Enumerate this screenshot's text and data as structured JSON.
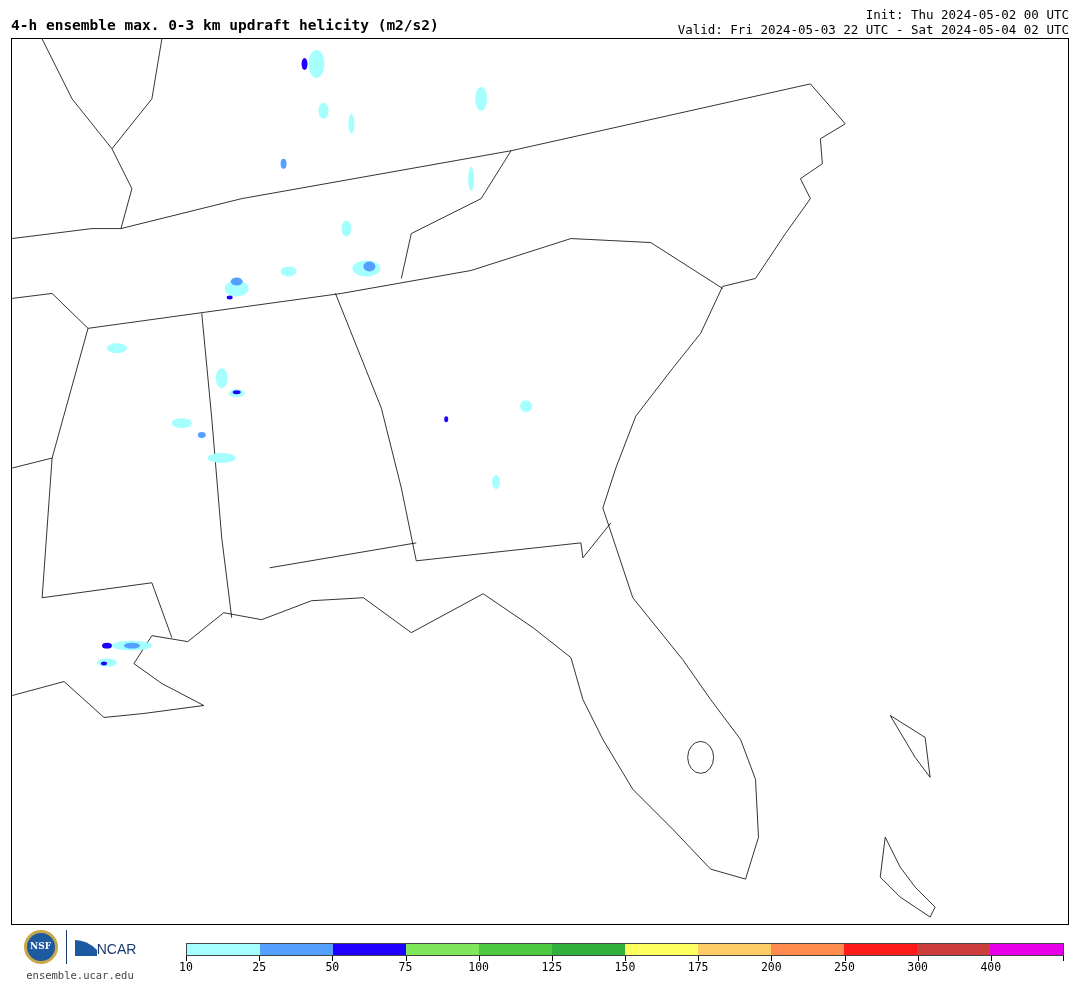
{
  "title": "4-h ensemble max. 0-3 km updraft helicity (m2/s2)",
  "init": "Init: Thu 2024-05-02 00 UTC",
  "valid": "Valid: Fri 2024-05-03 22 UTC - Sat 2024-05-04 02 UTC",
  "logo": {
    "seal_text": "NSF",
    "wordmark": "NCAR",
    "site": "ensemble.ucar.edu"
  },
  "colorbar": {
    "segments": [
      {
        "label": "10",
        "color": "#a6ffff"
      },
      {
        "label": "25",
        "color": "#55a0ff"
      },
      {
        "label": "50",
        "color": "#1e00ff"
      },
      {
        "label": "75",
        "color": "#80e65a"
      },
      {
        "label": "100",
        "color": "#4cc93f"
      },
      {
        "label": "125",
        "color": "#2eb03a"
      },
      {
        "label": "150",
        "color": "#ffff5f"
      },
      {
        "label": "175",
        "color": "#ffcc66"
      },
      {
        "label": "200",
        "color": "#ff8c4c"
      },
      {
        "label": "250",
        "color": "#ff1a1a"
      },
      {
        "label": "300",
        "color": "#cc3d3d"
      },
      {
        "label": "400",
        "color": "#e800e8"
      }
    ]
  }
}
